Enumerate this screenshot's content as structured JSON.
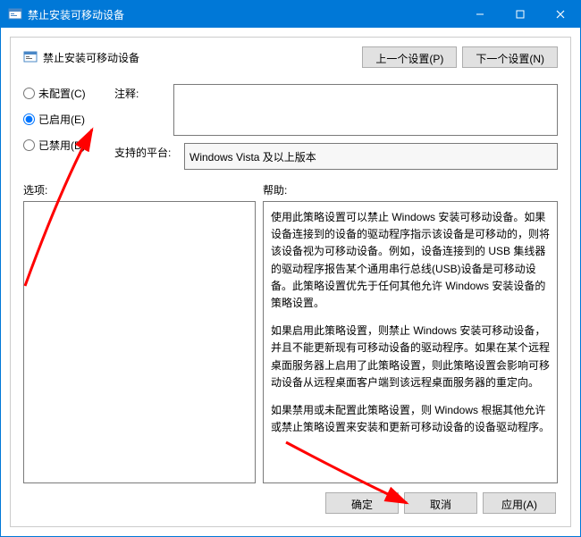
{
  "window": {
    "title": "禁止安装可移动设备"
  },
  "panel": {
    "title": "禁止安装可移动设备",
    "prev": "上一个设置(P)",
    "next": "下一个设置(N)"
  },
  "radios": {
    "notConfigured": "未配置(C)",
    "enabled": "已启用(E)",
    "disabled": "已禁用(D)"
  },
  "fields": {
    "commentLabel": "注释:",
    "commentValue": "",
    "platformLabel": "支持的平台:",
    "platformValue": "Windows Vista 及以上版本"
  },
  "labels": {
    "options": "选项:",
    "help": "帮助:"
  },
  "help": {
    "p1": "使用此策略设置可以禁止 Windows 安装可移动设备。如果设备连接到的设备的驱动程序指示该设备是可移动的，则将该设备视为可移动设备。例如，设备连接到的 USB 集线器的驱动程序报告某个通用串行总线(USB)设备是可移动设备。此策略设置优先于任何其他允许 Windows 安装设备的策略设置。",
    "p2": "如果启用此策略设置，则禁止 Windows 安装可移动设备，并且不能更新现有可移动设备的驱动程序。如果在某个远程桌面服务器上启用了此策略设置，则此策略设置会影响可移动设备从远程桌面客户端到该远程桌面服务器的重定向。",
    "p3": "如果禁用或未配置此策略设置，则 Windows 根据其他允许或禁止策略设置来安装和更新可移动设备的设备驱动程序。"
  },
  "footer": {
    "ok": "确定",
    "cancel": "取消",
    "apply": "应用(A)"
  }
}
